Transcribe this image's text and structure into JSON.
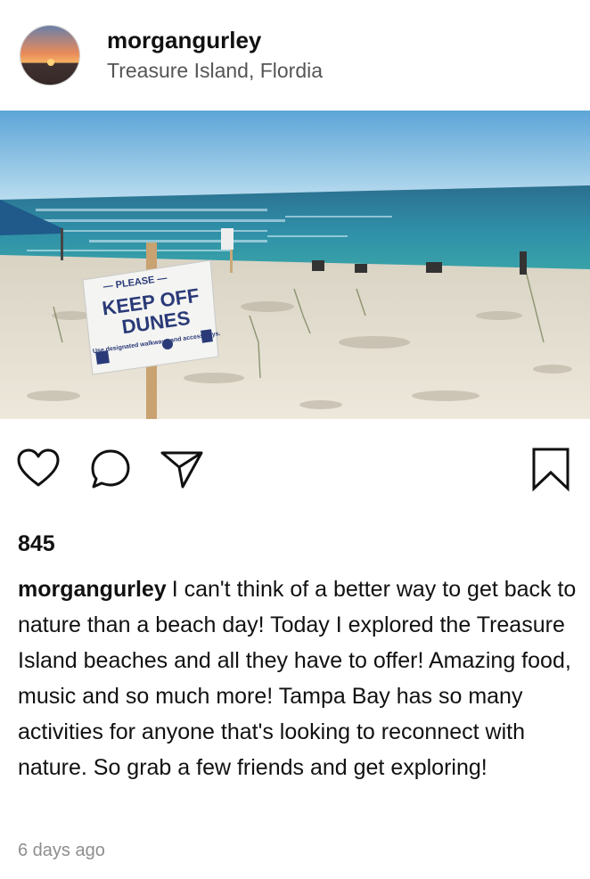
{
  "post": {
    "username": "morgangurley",
    "location": "Treasure Island, Flordia",
    "likes": "845",
    "caption": "I can't think of a better way to get back to nature than a beach day! Today I explored the Treasure Island beaches and all they have to offer! Amazing food, music and so much more! Tampa Bay has so many activities for anyone that's looking to reconnect with nature. So grab a few friends and get exploring!",
    "timestamp": "6 days ago"
  },
  "photo_sign": {
    "line1": "— PLEASE —",
    "line2": "KEEP OFF",
    "line3": "DUNES",
    "line4": "Use designated walkways and accessways."
  },
  "icons": {
    "like": "heart-icon",
    "comment": "comment-bubble-icon",
    "share": "paper-plane-icon",
    "save": "bookmark-icon"
  },
  "colors": {
    "text": "#111111",
    "secondary_text": "#555555",
    "timestamp": "#8e8e8e",
    "sky": "#8ec6e8",
    "ocean": "#2f8fb0",
    "sand": "#e6dfd0"
  }
}
